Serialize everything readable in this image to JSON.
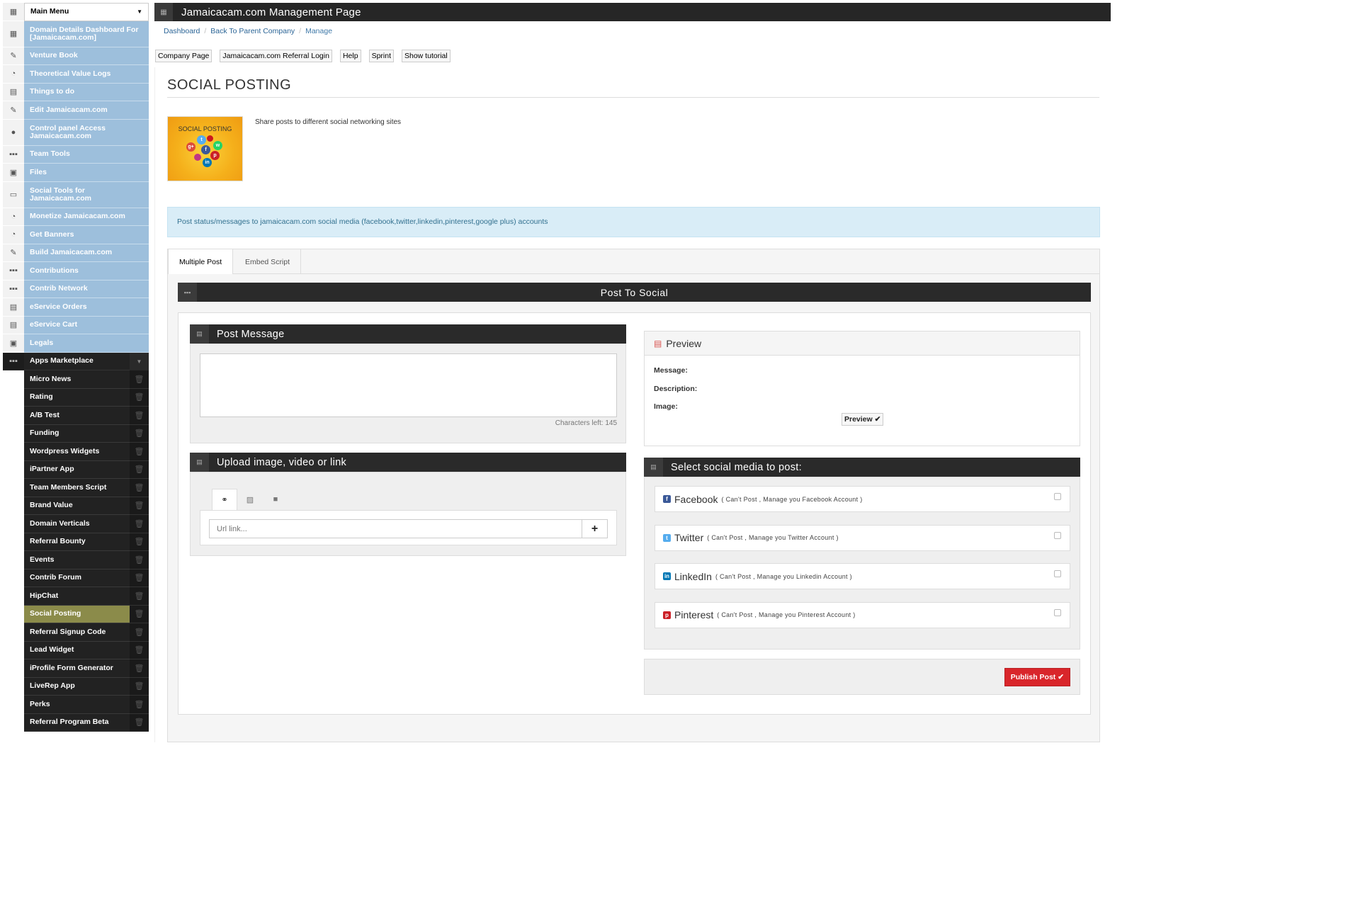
{
  "sidebar": {
    "main_menu": "Main Menu",
    "items": [
      {
        "label": "Domain Details Dashboard For [Jamaicacam.com]",
        "icon": "dashboard-icon",
        "glyph": "▦"
      },
      {
        "label": "Venture Book",
        "icon": "pencil-icon",
        "glyph": "✎"
      },
      {
        "label": "Theoretical Value Logs",
        "icon": "pie-chart-icon",
        "glyph": "◔"
      },
      {
        "label": "Things to do",
        "icon": "calendar-icon",
        "glyph": "▤"
      },
      {
        "label": "Edit Jamaicacam.com",
        "icon": "pencil-icon",
        "glyph": "✎"
      },
      {
        "label": "Control panel Access Jamaicacam.com",
        "icon": "mouse-icon",
        "glyph": "●"
      },
      {
        "label": "Team Tools",
        "icon": "grid-icon",
        "glyph": "▪▪▪"
      },
      {
        "label": "Files",
        "icon": "file-icon",
        "glyph": "▣"
      },
      {
        "label": "Social Tools for Jamaicacam.com",
        "icon": "monitor-icon",
        "glyph": "▭"
      },
      {
        "label": "Monetize Jamaicacam.com",
        "icon": "pie-chart-icon",
        "glyph": "◔"
      },
      {
        "label": "Get Banners",
        "icon": "pie-chart-icon",
        "glyph": "◔"
      },
      {
        "label": "Build Jamaicacam.com",
        "icon": "pencil-icon",
        "glyph": "✎"
      },
      {
        "label": "Contributions",
        "icon": "grid-icon",
        "glyph": "▪▪▪"
      },
      {
        "label": "Contrib Network",
        "icon": "grid-icon",
        "glyph": "▪▪▪"
      },
      {
        "label": "eService Orders",
        "icon": "calendar-icon",
        "glyph": "▤"
      },
      {
        "label": "eService Cart",
        "icon": "calendar-icon",
        "glyph": "▤"
      },
      {
        "label": "Legals",
        "icon": "file-icon",
        "glyph": "▣"
      }
    ],
    "apps_marketplace": "Apps Marketplace",
    "apps": [
      "Micro News",
      "Rating",
      "A/B Test",
      "Funding",
      "Wordpress Widgets",
      "iPartner App",
      "Team Members Script",
      "Brand Value",
      "Domain Verticals",
      "Referral Bounty",
      "Events",
      "Contrib Forum",
      "HipChat",
      "Social Posting",
      "Referral Signup Code",
      "Lead Widget",
      "iProfile Form Generator",
      "LiveRep App",
      "Perks",
      "Referral Program Beta"
    ],
    "active_app": "Social Posting"
  },
  "header": {
    "title": "Jamaicacam.com Management Page"
  },
  "breadcrumb": {
    "dashboard": "Dashboard",
    "parent": "Back To Parent Company",
    "current": "Manage"
  },
  "toolbar": [
    "Company Page",
    "Jamaicacam.com Referral Login",
    "Help",
    "Sprint",
    "Show tutorial"
  ],
  "page": {
    "title": "SOCIAL POSTING",
    "logo_text": "SOCIAL POSTING",
    "description": "Share posts to different social networking sites",
    "alert": "Post status/messages to jamaicacam.com social media (facebook,twitter,linkedin,pinterest,google plus) accounts"
  },
  "tabs": {
    "multiple_post": "Multiple Post",
    "embed_script": "Embed Script"
  },
  "post_to_social": {
    "title": "Post To Social",
    "post_message": {
      "title": "Post Message",
      "chars_left": "Characters left: 145"
    },
    "upload": {
      "title": "Upload image, video or link",
      "url_placeholder": "Url link...",
      "add_label": "+"
    },
    "preview": {
      "title": "Preview",
      "message_label": "Message:",
      "description_label": "Description:",
      "image_label": "Image:",
      "button": "Preview ✔"
    },
    "select": {
      "title": "Select social media to post:",
      "networks": [
        {
          "name": "Facebook",
          "note": "( Can't Post , Manage you Facebook Account )",
          "color": "#3b5998",
          "glyph": "f",
          "icon": "facebook-icon"
        },
        {
          "name": "Twitter",
          "note": "( Can't Post , Manage you Twitter Account )",
          "color": "#55acee",
          "glyph": "t",
          "icon": "twitter-icon"
        },
        {
          "name": "LinkedIn",
          "note": "( Can't Post , Manage you Linkedin Account )",
          "color": "#0077b5",
          "glyph": "in",
          "icon": "linkedin-icon"
        },
        {
          "name": "Pinterest",
          "note": "( Can't Post , Manage you Pinterest Account )",
          "color": "#cb2027",
          "glyph": "p",
          "icon": "pinterest-icon"
        }
      ]
    },
    "publish": "Publish Post ✔"
  }
}
